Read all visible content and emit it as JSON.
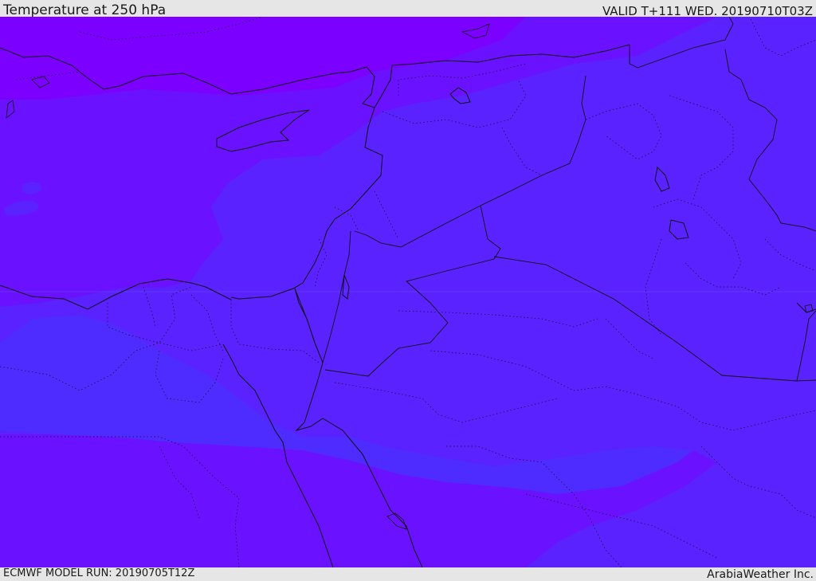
{
  "header": {
    "title": "Temperature at 250 hPa",
    "valid": "VALID T+111 WED. 20190710T03Z"
  },
  "footer": {
    "model_run": "ECMWF MODEL RUN: 20190705T12Z",
    "credit": "ArabiaWeather Inc."
  },
  "map": {
    "colors": {
      "coldest": "#7c00ff",
      "cold": "#6a12ff",
      "mid": "#5a22ff",
      "warm": "#4e2cff",
      "border": "#111111",
      "grid": "#6e5cff"
    }
  }
}
